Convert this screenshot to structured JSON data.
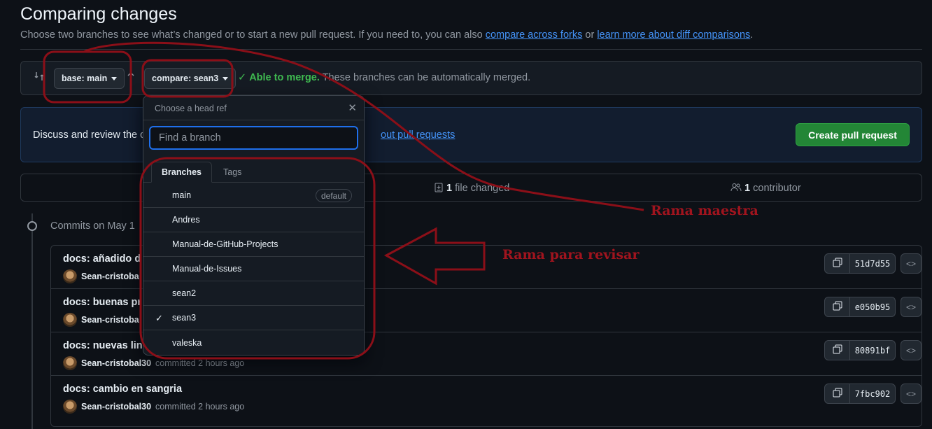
{
  "header": {
    "title": "Comparing changes",
    "subtitle_text": "Choose two branches to see what’s changed or to start a new pull request. If you need to, you can also",
    "link_forks": "compare across forks",
    "or_text": "or",
    "link_learn": "learn more about diff comparisons",
    "period": "."
  },
  "range": {
    "base_label": "base: main",
    "compare_label": "compare: sean3",
    "merge_ok": "Able to merge.",
    "merge_detail": "These branches can be automatically merged."
  },
  "discuss": {
    "text": "Discuss and review the c",
    "link": "out pull requests",
    "create_button": "Create pull request"
  },
  "stats": {
    "files_count": "1",
    "files_label": "file changed",
    "contributors_count": "1",
    "contributors_label": "contributor"
  },
  "commits_heading": "Commits on May 1",
  "commits": [
    {
      "title": "docs: añadido d",
      "author": "Sean-cristoba",
      "time": "",
      "sha": "51d7d55"
    },
    {
      "title": "docs: buenas pr",
      "author": "Sean-cristoba",
      "time": "",
      "sha": "e050b95"
    },
    {
      "title": "docs: nuevas line",
      "author": "Sean-cristobal30",
      "time": "committed 2 hours ago",
      "sha": "80891bf"
    },
    {
      "title": "docs: cambio en sangria",
      "author": "Sean-cristobal30",
      "time": "committed 2 hours ago",
      "sha": "7fbc902"
    }
  ],
  "dropdown": {
    "title": "Choose a head ref",
    "search_placeholder": "Find a branch",
    "tabs": [
      "Branches",
      "Tags"
    ],
    "default_badge": "default",
    "branches": [
      "main",
      "Andres",
      "Manual-de-GitHub-Projects",
      "Manual-de-Issues",
      "sean2",
      "sean3",
      "valeska"
    ],
    "selected": "sean3"
  },
  "annotations": {
    "master": "Rama maestra",
    "review": "Rama para revisar",
    "color": "#a0141e"
  },
  "colors": {
    "background": "#0d1117",
    "accent_link": "#4493f8",
    "success": "#3fb950",
    "primary_button": "#238636"
  }
}
